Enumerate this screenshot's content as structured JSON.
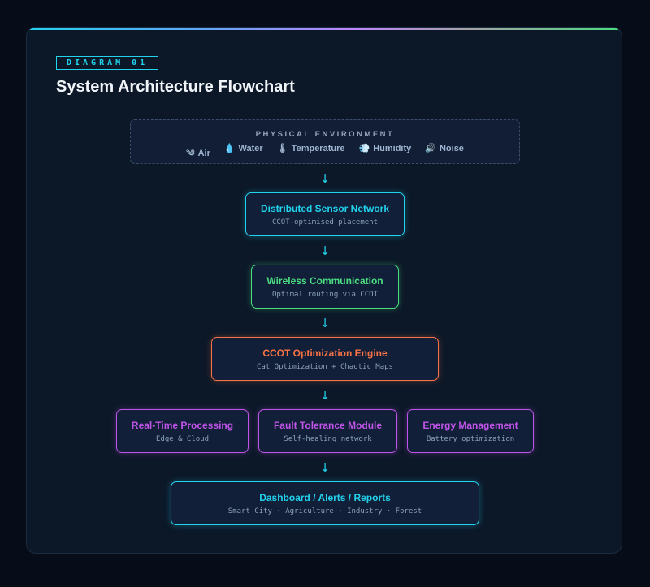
{
  "header": {
    "badge": "DIAGRAM 01",
    "title": "System Architecture Flowchart"
  },
  "environment": {
    "title": "PHYSICAL ENVIRONMENT",
    "items": [
      {
        "icon": "wind-icon",
        "glyph": "༄",
        "label": "Air"
      },
      {
        "icon": "droplet-icon",
        "glyph": "💧",
        "label": "Water"
      },
      {
        "icon": "thermometer-icon",
        "glyph": "🌡",
        "label": "Temperature"
      },
      {
        "icon": "vapor-icon",
        "glyph": "💨",
        "label": "Humidity"
      },
      {
        "icon": "speaker-icon",
        "glyph": "🔊",
        "label": "Noise"
      }
    ]
  },
  "nodes": {
    "sensor": {
      "title": "Distributed Sensor Network",
      "subtitle": "CCOT-optimised placement"
    },
    "wireless": {
      "title": "Wireless Communication",
      "subtitle": "Optimal routing via CCOT"
    },
    "engine": {
      "title": "CCOT Optimization Engine",
      "subtitle": "Cat Optimization + Chaotic Maps"
    },
    "processing": {
      "title": "Real-Time Processing",
      "subtitle": "Edge & Cloud"
    },
    "fault": {
      "title": "Fault Tolerance Module",
      "subtitle": "Self-healing network"
    },
    "energy": {
      "title": "Energy Management",
      "subtitle": "Battery optimization"
    },
    "dashboard": {
      "title": "Dashboard / Alerts / Reports",
      "subtitle": "Smart City · Agriculture · Industry · Forest"
    }
  },
  "arrow_glyph": "↓",
  "colors": {
    "cyan": "#22d3ee",
    "green": "#4ade80",
    "orange": "#f97346",
    "purple": "#c054e8"
  }
}
